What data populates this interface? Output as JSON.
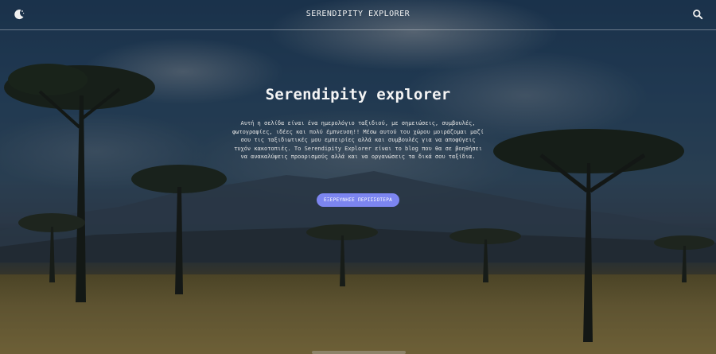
{
  "header": {
    "site_title": "SERENDIPITY EXPLORER",
    "logo_icon": "moon-icon",
    "search_icon": "search-icon"
  },
  "hero": {
    "title": "Serendipity explorer",
    "intro": "Αυτή η σελίδα είναι ένα ημερολόγιο ταξιδιού, με σημειώσεις, συμβουλές, φωτογραφίες, ιδέες και πολύ έμπνευση!! Μέσω αυτού του χώρου μοιράζομαι μαζί σου τις ταξιδιωτικές μου εμπειρίες αλλά και συμβουλές για να αποφύγεις τυχόν κακοτοπιές. Το Serendipity Explorer είναι το blog που θα σε βοηθήσει να ανακαλύψεις προορισμούς αλλά και να οργανώσεις τα δικά σου ταξίδια.",
    "cta_label": "ΕΞΕΡΕΥΝΗΣΕ ΠΕΡΙΣΣΟΤΕΡΑ"
  },
  "colors": {
    "accent": "#7c85f0",
    "text": "#f0f0f0"
  }
}
